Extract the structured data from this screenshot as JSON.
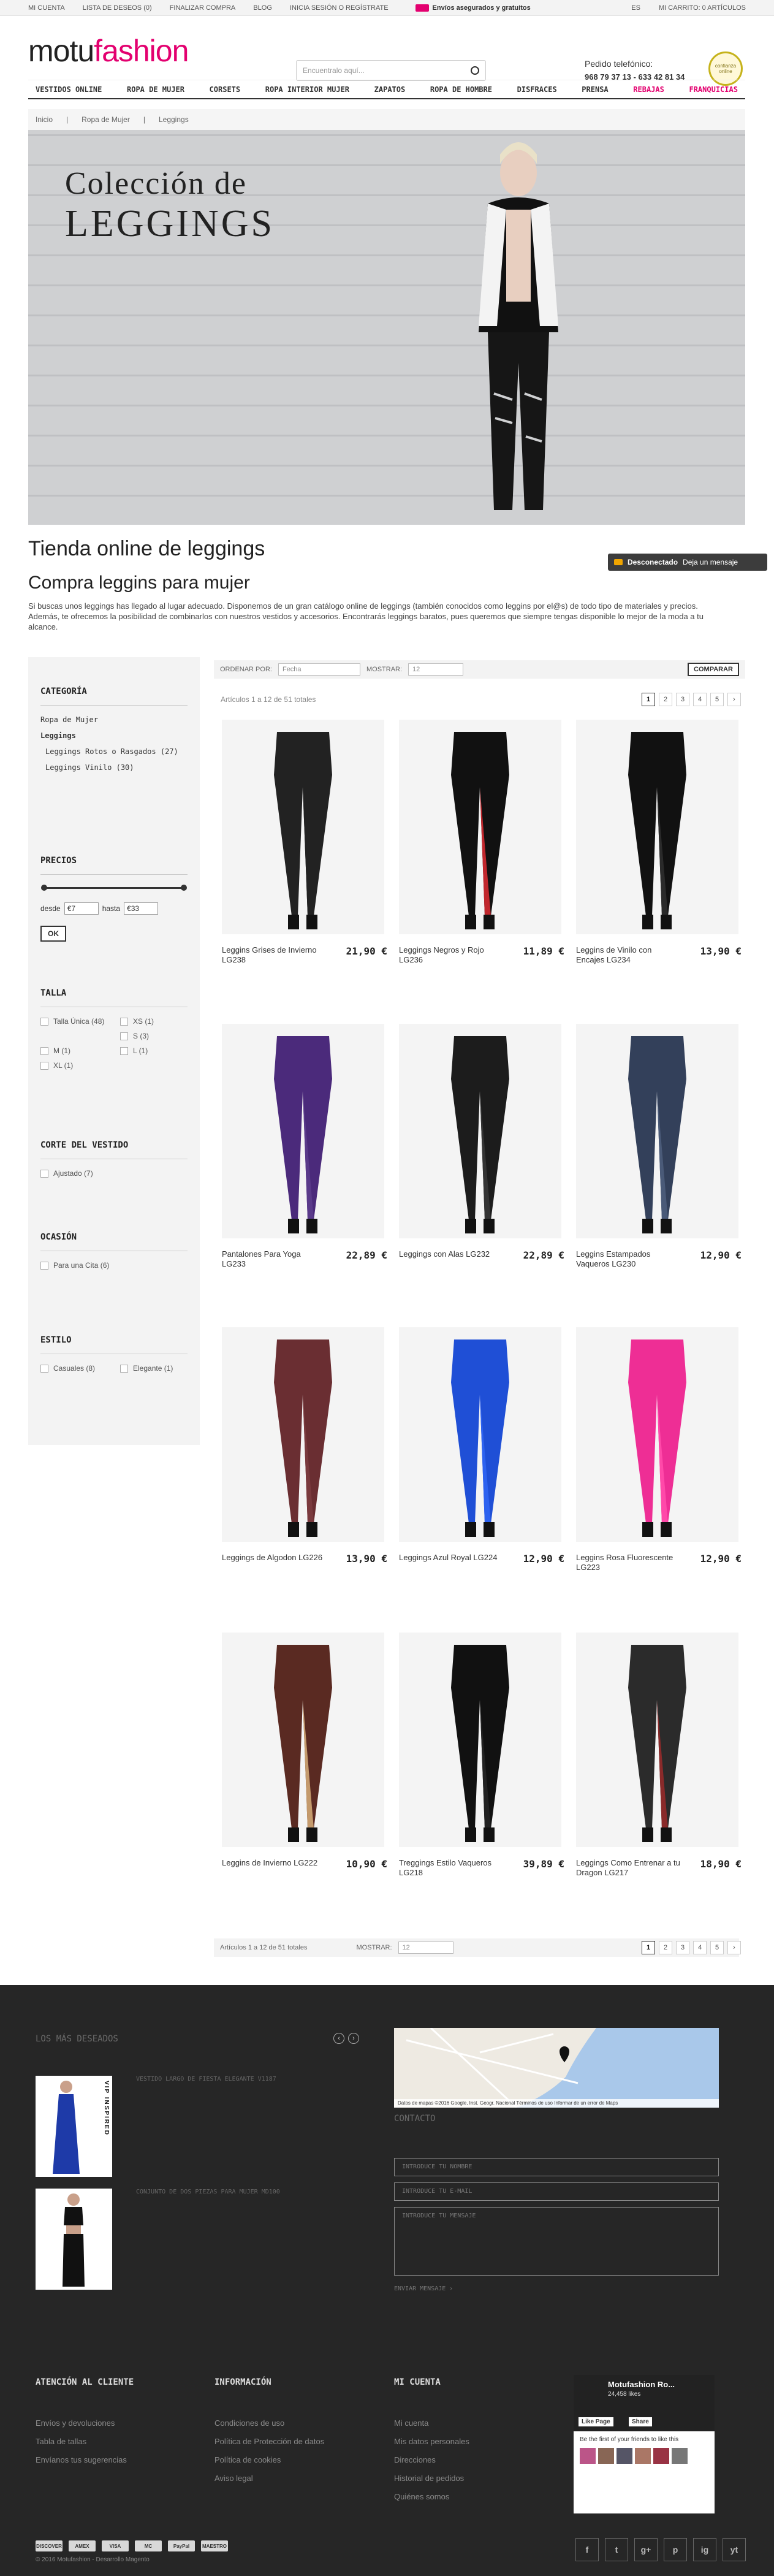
{
  "topbar": {
    "links": [
      "Mi cuenta",
      "Lista de deseos (0)",
      "Finalizar compra",
      "Blog",
      "Inicia sesión o regístrate"
    ],
    "shipping": "Envíos asegurados y gratuitos",
    "lang": "ES",
    "cart": "Mi carrito: 0 artículos"
  },
  "header": {
    "logo_a": "motu",
    "logo_b": "fashion",
    "search_placeholder": "Encuentralo aquí...",
    "phone_label": "Pedido telefónico:",
    "phone_numbers": "968 79 37 13 - 633 42 81 34",
    "seal": "confianza online"
  },
  "nav": [
    "VESTIDOS ONLINE",
    "ROPA DE MUJER",
    "CORSETS",
    "ROPA INTERIOR MUJER",
    "ZAPATOS",
    "ROPA DE HOMBRE",
    "DISFRACES",
    "PRENSA",
    "REBAJAS",
    "FRANQUICIAS"
  ],
  "breadcrumb": [
    "Inicio",
    "Ropa de Mujer",
    "Leggings"
  ],
  "banner": {
    "line1": "Colección de",
    "line2": "LEGGINGS"
  },
  "page": {
    "title": "Tienda online de leggings",
    "subtitle": "Compra leggins para mujer",
    "intro": "Si buscas unos leggings has llegado al lugar adecuado. Disponemos de un gran catálogo online de leggings (también conocidos como leggins por el@s) de todo tipo de materiales y precios. Además, te ofrecemos la posibilidad de combinarlos con nuestros vestidos y accesorios. Encontrarás leggings baratos, pues queremos que siempre tengas disponible lo mejor de la moda a tu alcance."
  },
  "chat": {
    "status": "Desconectado",
    "action": "Deja un mensaje"
  },
  "sidebar": {
    "categoria_title": "Categoría",
    "categories": [
      "Ropa de Mujer",
      "Leggings",
      "Leggings Rotos o Rasgados (27)",
      "Leggings Vinilo (30)"
    ],
    "precios_title": "Precios",
    "desde": "desde",
    "hasta": "hasta",
    "min": "€7",
    "max": "€33",
    "ok": "OK",
    "talla_title": "Talla",
    "tallas": [
      "Talla Única (48)",
      "XS (1)",
      "S (3)",
      "M (1)",
      "L (1)",
      "XL (1)"
    ],
    "corte_title": "Corte del vestido",
    "cortes": [
      "Ajustado (7)"
    ],
    "ocasion_title": "Ocasión",
    "ocasiones": [
      "Para una Cita (6)"
    ],
    "estilo_title": "Estilo",
    "estilos": [
      "Casuales (8)",
      "Elegante (1)"
    ]
  },
  "toolbar": {
    "order_label": "ORDENAR POR:",
    "order_value": "Fecha",
    "show_label": "MOSTRAR:",
    "show_value": "12",
    "compare": "COMPARAR",
    "info": "Artículos 1 a 12 de 51 totales",
    "pages": [
      "1",
      "2",
      "3",
      "4",
      "5",
      "›"
    ]
  },
  "products": [
    {
      "name": "Leggins Grises de Invierno LG238",
      "price": "21,90 €"
    },
    {
      "name": "Leggings Negros y Rojo LG236",
      "price": "11,89 €"
    },
    {
      "name": "Leggins de Vinilo con Encajes LG234",
      "price": "13,90 €"
    },
    {
      "name": "Pantalones Para Yoga LG233",
      "price": "22,89 €"
    },
    {
      "name": "Leggings con Alas LG232",
      "price": "22,89 €"
    },
    {
      "name": "Leggins Estampados Vaqueros LG230",
      "price": "12,90 €"
    },
    {
      "name": "Leggings de Algodon LG226",
      "price": "13,90 €"
    },
    {
      "name": "Leggings Azul Royal LG224",
      "price": "12,90 €"
    },
    {
      "name": "Leggins Rosa Fluorescente LG223",
      "price": "12,90 €"
    },
    {
      "name": "Leggins de Invierno LG222",
      "price": "10,90 €"
    },
    {
      "name": "Treggings Estilo Vaqueros LG218",
      "price": "39,89 €"
    },
    {
      "name": "Leggings Como Entrenar a tu Dragon LG217",
      "price": "18,90 €"
    }
  ],
  "footer": {
    "deseados_title": "Los más deseados",
    "deseados": [
      "VESTIDO LARGO DE FIESTA ELEGANTE V1187",
      "CONJUNTO DE DOS PIEZAS PARA MUJER MD100"
    ],
    "vip": "VIP INSPIRED",
    "contacto_title": "Contacto",
    "name_ph": "Introduce tu nombre",
    "email_ph": "Introduce tu e-mail",
    "msg_ph": "Introduce tu mensaje",
    "send": "Enviar mensaje ›",
    "map_footer": "Datos de mapas ©2016 Google, Inst. Geogr. Nacional   Términos de uso   Informar de un error de Maps",
    "atencion_title": "Atención al cliente",
    "atencion": [
      "Envíos y devoluciones",
      "Tabla de tallas",
      "Envíanos tus sugerencias"
    ],
    "info_title": "Información",
    "info": [
      "Condiciones de uso",
      "Política de Protección de datos",
      "Política de cookies",
      "Aviso legal"
    ],
    "cuenta_title": "Mi cuenta",
    "cuenta": [
      "Mi cuenta",
      "Mis datos personales",
      "Direcciones",
      "Historial de pedidos",
      "Quiénes somos"
    ],
    "fb_name": "Motufashion Ro...",
    "fb_likes": "24,458 likes",
    "fb_like": "Like Page",
    "fb_share": "Share",
    "fb_friends": "Be the first of your friends to like this",
    "payments": [
      "DISCOVER",
      "AMEX",
      "VISA",
      "MC",
      "PayPal",
      "MAESTRO"
    ],
    "copyright": "© 2016 Motufashion - Desarrollo Magento",
    "social": [
      "f",
      "t",
      "g+",
      "p",
      "ig",
      "yt"
    ]
  }
}
